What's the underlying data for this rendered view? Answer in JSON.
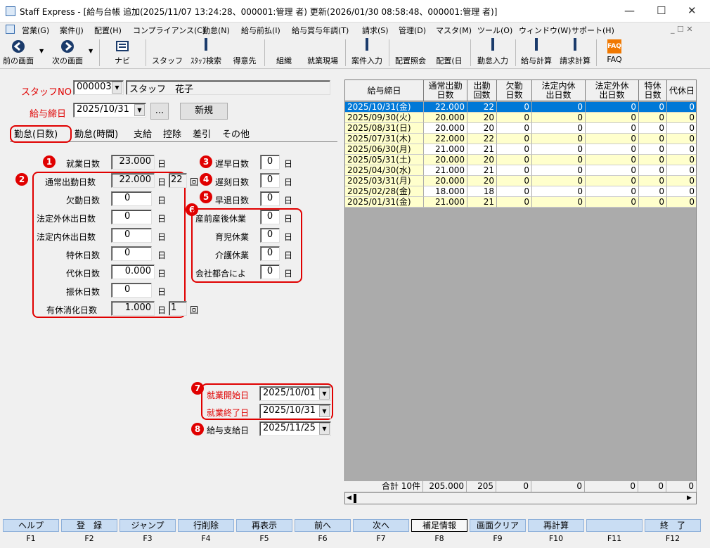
{
  "window": {
    "title": "Staff Express - [給与台帳 追加(2025/11/07 13:24:28、000001:管理 者) 更新(2026/01/30 08:58:48、000001:管理 者)]",
    "minimize": "—",
    "maximize": "☐",
    "close": "✕"
  },
  "menu": [
    "営業(G)",
    "案件(J)",
    "配置(H)",
    "コンプライアンス(C)",
    "勤怠(N)",
    "給与前払(I)",
    "給与賞与年調(T)",
    "請求(S)",
    "管理(D)",
    "マスタ(M)",
    "ツール(O)",
    "ウィンドウ(W)",
    "サポート(H)"
  ],
  "mdi_controls": "_ ☐ ✕",
  "toolbar": {
    "back": "前の画面",
    "next": "次の画面",
    "navi": "ナビ",
    "staff": "スタッフ",
    "staff_search": "ｽﾀｯﾌ検索",
    "client": "得意先",
    "org": "組織",
    "site": "就業現場",
    "case_input": "案件入力",
    "assign_inquiry": "配置照会",
    "assign": "配置(日",
    "attendance": "勤怠入力",
    "payroll_calc": "給与計算",
    "billing_calc": "請求計算",
    "faq": "FAQ",
    "faq_icon": "FAQ"
  },
  "form": {
    "staff_no_label": "スタッフNO",
    "staff_no": "000003",
    "staff_name": "スタッフ　花子",
    "pay_close_label": "給与締日",
    "pay_close": "2025/10/31",
    "ellipsis": "...",
    "new_btn": "新規",
    "tabs": [
      "勤怠(日数)",
      "勤怠(時間)",
      "支給",
      "控除",
      "差引",
      "その他"
    ],
    "nums": [
      "1",
      "2",
      "3",
      "4",
      "5",
      "6",
      "7",
      "8"
    ],
    "work_days_label": "就業日数",
    "work_days": "23.000",
    "normal_days_label": "通常出勤日数",
    "normal_days": "22.000",
    "normal_count": "22",
    "count_unit": "回",
    "absent_label": "欠勤日数",
    "absent": "0",
    "legal_out_label": "法定外休出日数",
    "legal_out": "0",
    "legal_in_label": "法定内休出日数",
    "legal_in": "0",
    "special_label": "特休日数",
    "special": "0",
    "compensatory_label": "代休日数",
    "compensatory": "0.000",
    "substitute_label": "振休日数",
    "substitute": "0",
    "paid_leave_label": "有休消化日数",
    "paid_leave": "1.000",
    "paid_leave_count": "1",
    "day_unit": "日",
    "early_label": "遅早日数",
    "early": "0",
    "late_label": "遅刻日数",
    "late": "0",
    "leave_early_label": "早退日数",
    "leave_early": "0",
    "maternity_label": "産前産後休業",
    "maternity": "0",
    "childcare_label": "育児休業",
    "childcare": "0",
    "nursing_label": "介護休業",
    "nursing": "0",
    "company_label": "会社都合によ",
    "company": "0",
    "work_start_label": "就業開始日",
    "work_start": "2025/10/01",
    "work_end_label": "就業終了日",
    "work_end": "2025/10/31",
    "pay_date_label": "給与支給日",
    "pay_date": "2025/11/25"
  },
  "grid": {
    "headers": [
      "給与締日",
      "通常出勤\n日数",
      "出勤\n回数",
      "欠勤\n日数",
      "法定内休\n出日数",
      "法定外休\n出日数",
      "特休\n日数",
      "代休日"
    ],
    "rows": [
      [
        "2025/10/31(金)",
        "22.000",
        "22",
        "0",
        "0",
        "0",
        "0",
        "0"
      ],
      [
        "2025/09/30(火)",
        "20.000",
        "20",
        "0",
        "0",
        "0",
        "0",
        "0"
      ],
      [
        "2025/08/31(日)",
        "20.000",
        "20",
        "0",
        "0",
        "0",
        "0",
        "0"
      ],
      [
        "2025/07/31(木)",
        "22.000",
        "22",
        "0",
        "0",
        "0",
        "0",
        "0"
      ],
      [
        "2025/06/30(月)",
        "21.000",
        "21",
        "0",
        "0",
        "0",
        "0",
        "0"
      ],
      [
        "2025/05/31(土)",
        "20.000",
        "20",
        "0",
        "0",
        "0",
        "0",
        "0"
      ],
      [
        "2025/04/30(水)",
        "21.000",
        "21",
        "0",
        "0",
        "0",
        "0",
        "0"
      ],
      [
        "2025/03/31(月)",
        "20.000",
        "20",
        "0",
        "0",
        "0",
        "0",
        "0"
      ],
      [
        "2025/02/28(金)",
        "18.000",
        "18",
        "0",
        "0",
        "0",
        "0",
        "0"
      ],
      [
        "2025/01/31(金)",
        "21.000",
        "21",
        "0",
        "0",
        "0",
        "0",
        "0"
      ]
    ],
    "totals": [
      "合計 10件",
      "205.000",
      "205",
      "0",
      "0",
      "0",
      "0",
      "0"
    ]
  },
  "fkeys": [
    {
      "label": "ヘルプ",
      "key": "F1"
    },
    {
      "label": "登　録",
      "key": "F2"
    },
    {
      "label": "ジャンプ",
      "key": "F3"
    },
    {
      "label": "行削除",
      "key": "F4"
    },
    {
      "label": "再表示",
      "key": "F5"
    },
    {
      "label": "前へ",
      "key": "F6"
    },
    {
      "label": "次へ",
      "key": "F7"
    },
    {
      "label": "補足情報",
      "key": "F8"
    },
    {
      "label": "画面クリア",
      "key": "F9"
    },
    {
      "label": "再計算",
      "key": "F10"
    },
    {
      "label": "",
      "key": "F11"
    },
    {
      "label": "終　了",
      "key": "F12"
    }
  ],
  "colors": {
    "selected_row": "#0078d7",
    "yellow_row": "#ffffcc",
    "white_row": "#ffffff",
    "highlight_red": "#e00000",
    "fkey": "#c9ddf3"
  }
}
